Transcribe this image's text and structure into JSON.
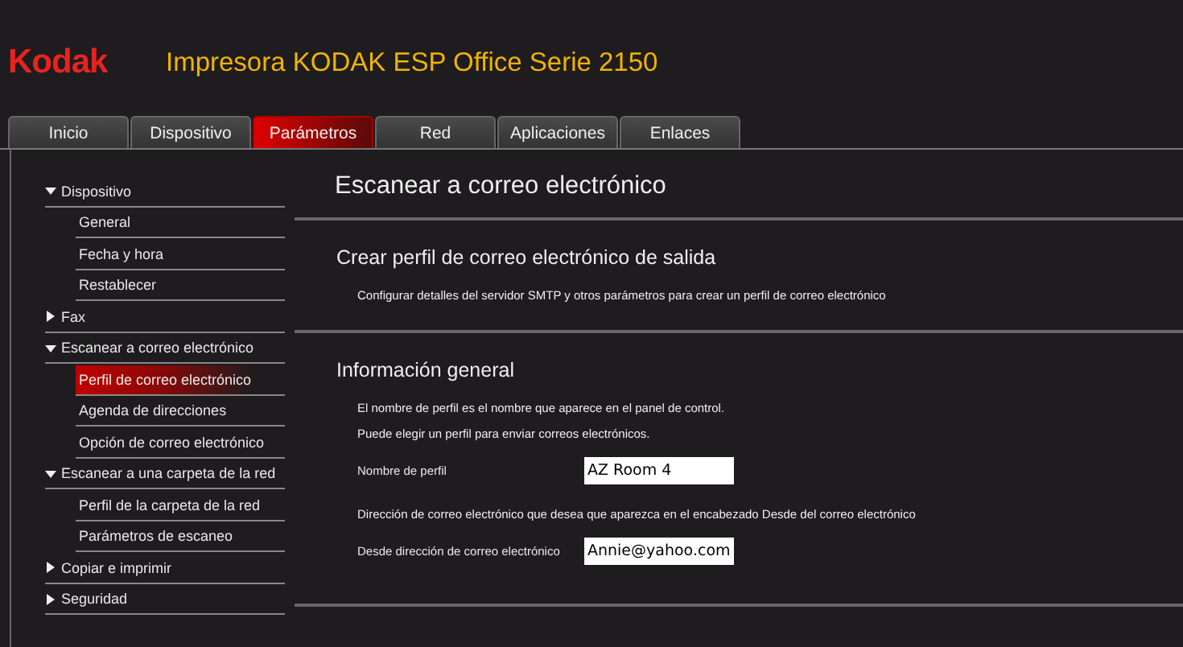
{
  "header": {
    "logo": "Kodak",
    "title": "Impresora KODAK ESP Office Serie 2150"
  },
  "tabs": [
    {
      "label": "Inicio",
      "selected": false
    },
    {
      "label": "Dispositivo",
      "selected": false
    },
    {
      "label": "Parámetros",
      "selected": true
    },
    {
      "label": "Red",
      "selected": false
    },
    {
      "label": "Aplicaciones",
      "selected": false
    },
    {
      "label": "Enlaces",
      "selected": false
    }
  ],
  "sidebar": {
    "items": [
      {
        "label": "Dispositivo",
        "expanded": true,
        "children": [
          {
            "label": "General",
            "selected": false
          },
          {
            "label": "Fecha y hora",
            "selected": false
          },
          {
            "label": "Restablecer",
            "selected": false
          }
        ]
      },
      {
        "label": "Fax",
        "expanded": false
      },
      {
        "label": "Escanear a correo electrónico",
        "expanded": true,
        "children": [
          {
            "label": "Perfil de correo electrónico",
            "selected": true
          },
          {
            "label": "Agenda de direcciones",
            "selected": false
          },
          {
            "label": "Opción de correo electrónico",
            "selected": false
          }
        ]
      },
      {
        "label": "Escanear a una carpeta de la red",
        "expanded": true,
        "children": [
          {
            "label": "Perfil de la carpeta de la red",
            "selected": false
          },
          {
            "label": "Parámetros de escaneo",
            "selected": false
          }
        ]
      },
      {
        "label": "Copiar e imprimir",
        "expanded": false
      },
      {
        "label": "Seguridad",
        "expanded": false
      }
    ]
  },
  "main": {
    "title": "Escanear a correo electrónico",
    "sections": [
      {
        "heading": "Crear perfil de correo electrónico de salida",
        "blocks": [
          {
            "kind": "text",
            "text": "Configurar detalles del servidor SMTP y otros parámetros para crear un perfil de correo electrónico"
          }
        ]
      },
      {
        "heading": "Información general",
        "blocks": [
          {
            "kind": "text",
            "text": "El nombre de perfil es el nombre que aparece en el panel de control."
          },
          {
            "kind": "text",
            "text": "Puede elegir un perfil para enviar correos electrónicos."
          },
          {
            "kind": "field",
            "label": "Nombre de perfil",
            "value": "AZ Room 4"
          },
          {
            "kind": "text",
            "text": "Dirección de correo electrónico que desea que aparezca en el encabezado Desde del correo electrónico"
          },
          {
            "kind": "field",
            "label": "Desde dirección de correo electrónico",
            "value": "Annie@yahoo.com"
          }
        ]
      }
    ]
  }
}
